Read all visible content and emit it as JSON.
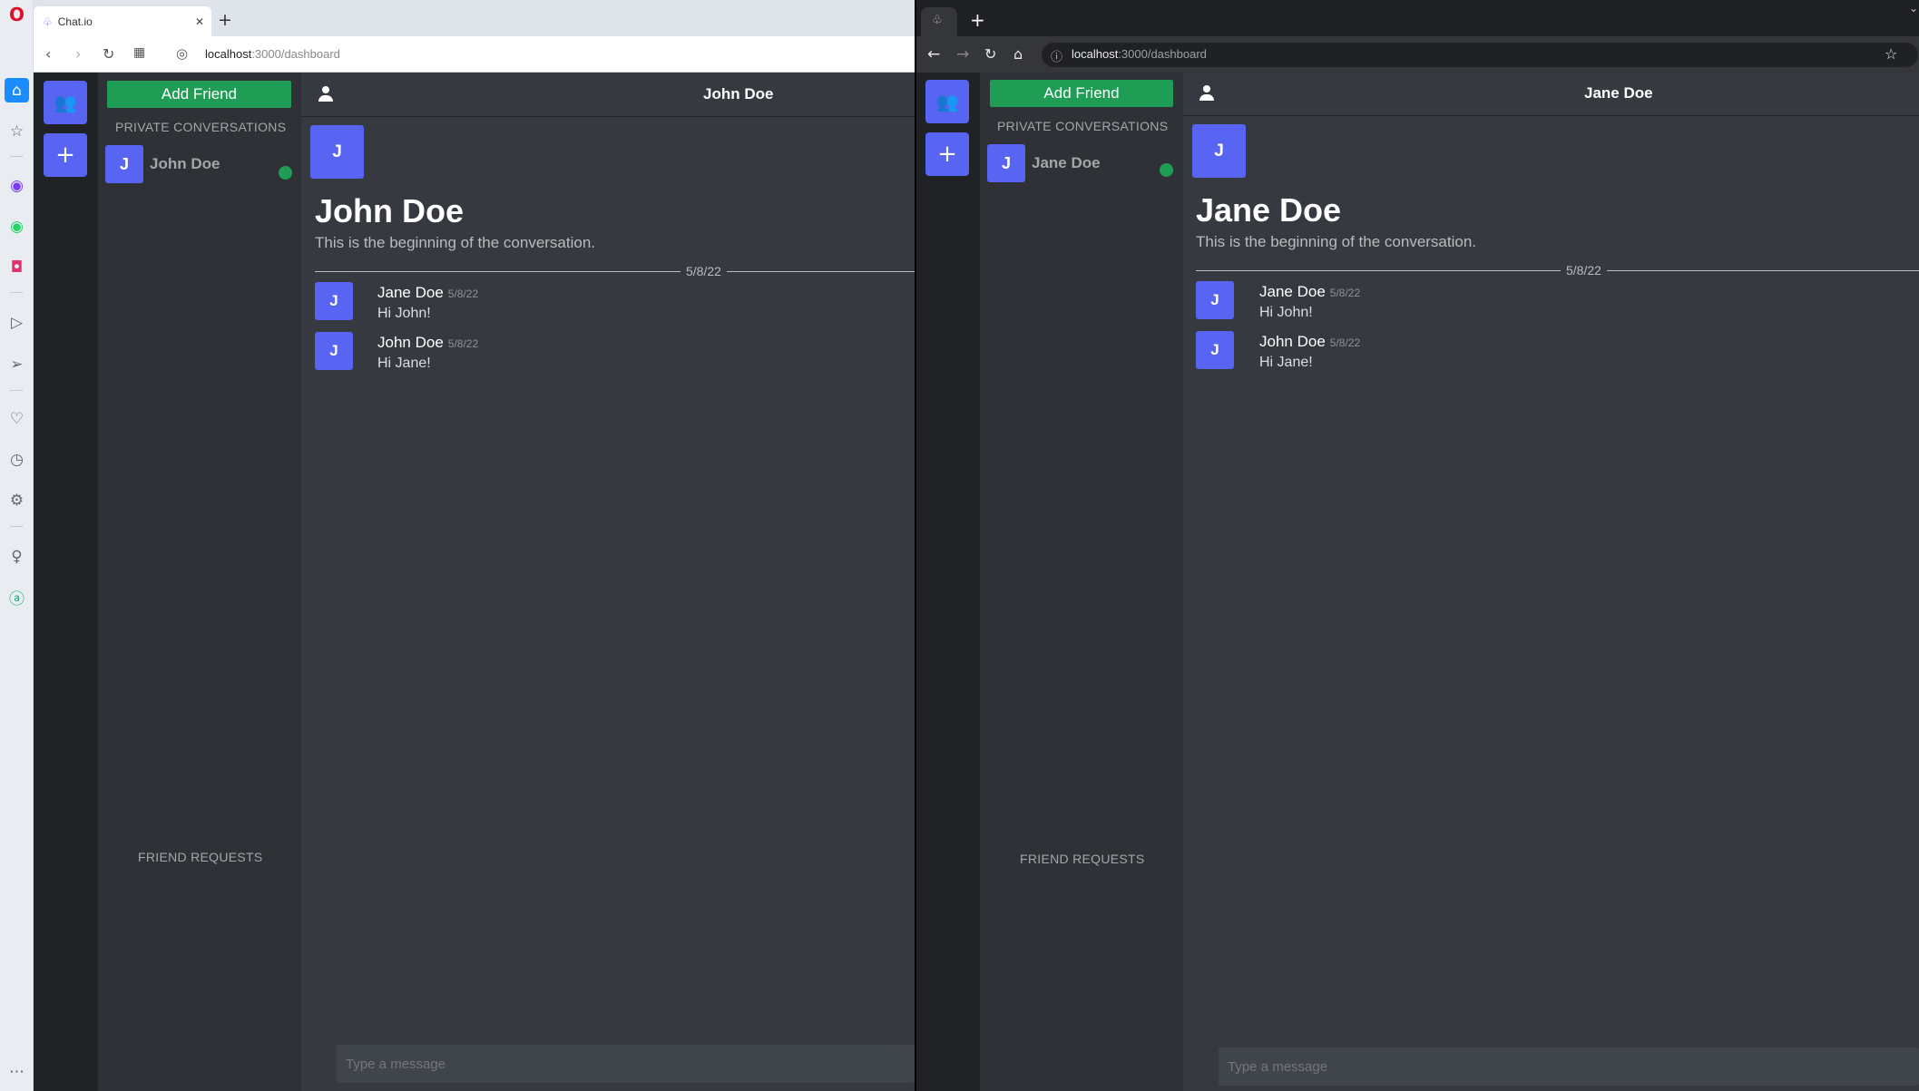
{
  "opera": {
    "tab_title": "Chat.io",
    "tab_close": "✕",
    "new_tab": "+",
    "url_host": "localhost",
    "url_path": ":3000/dashboard"
  },
  "chrome": {
    "new_tab": "+",
    "url_host": "localhost",
    "url_path": ":3000/dashboard"
  },
  "left_app": {
    "add_friend": "Add Friend",
    "private_conversations": "PRIVATE CONVERSATIONS",
    "friend_requests": "FRIEND REQUESTS",
    "conversation": {
      "initial": "J",
      "name": "John Doe"
    },
    "header_title": "John Doe",
    "chat": {
      "avatar_initial": "J",
      "title": "John Doe",
      "beginning": "This is the beginning of the conversation.",
      "date_divider": "5/8/22",
      "messages": [
        {
          "initial": "J",
          "author": "Jane Doe",
          "date": "5/8/22",
          "text": "Hi John!"
        },
        {
          "initial": "J",
          "author": "John Doe",
          "date": "5/8/22",
          "text": "Hi Jane!"
        }
      ]
    },
    "composer_placeholder": "Type a message"
  },
  "right_app": {
    "add_friend": "Add Friend",
    "private_conversations": "PRIVATE CONVERSATIONS",
    "friend_requests": "FRIEND REQUESTS",
    "conversation": {
      "initial": "J",
      "name": "Jane Doe"
    },
    "header_title": "Jane Doe",
    "chat": {
      "avatar_initial": "J",
      "title": "Jane Doe",
      "beginning": "This is the beginning of the conversation.",
      "date_divider": "5/8/22",
      "messages": [
        {
          "initial": "J",
          "author": "Jane Doe",
          "date": "5/8/22",
          "text": "Hi John!"
        },
        {
          "initial": "J",
          "author": "John Doe",
          "date": "5/8/22",
          "text": "Hi Jane!"
        }
      ]
    },
    "composer_placeholder": "Type a message"
  },
  "colors": {
    "accent": "#5865f2",
    "success": "#1f9d55",
    "background": "#36393f"
  }
}
